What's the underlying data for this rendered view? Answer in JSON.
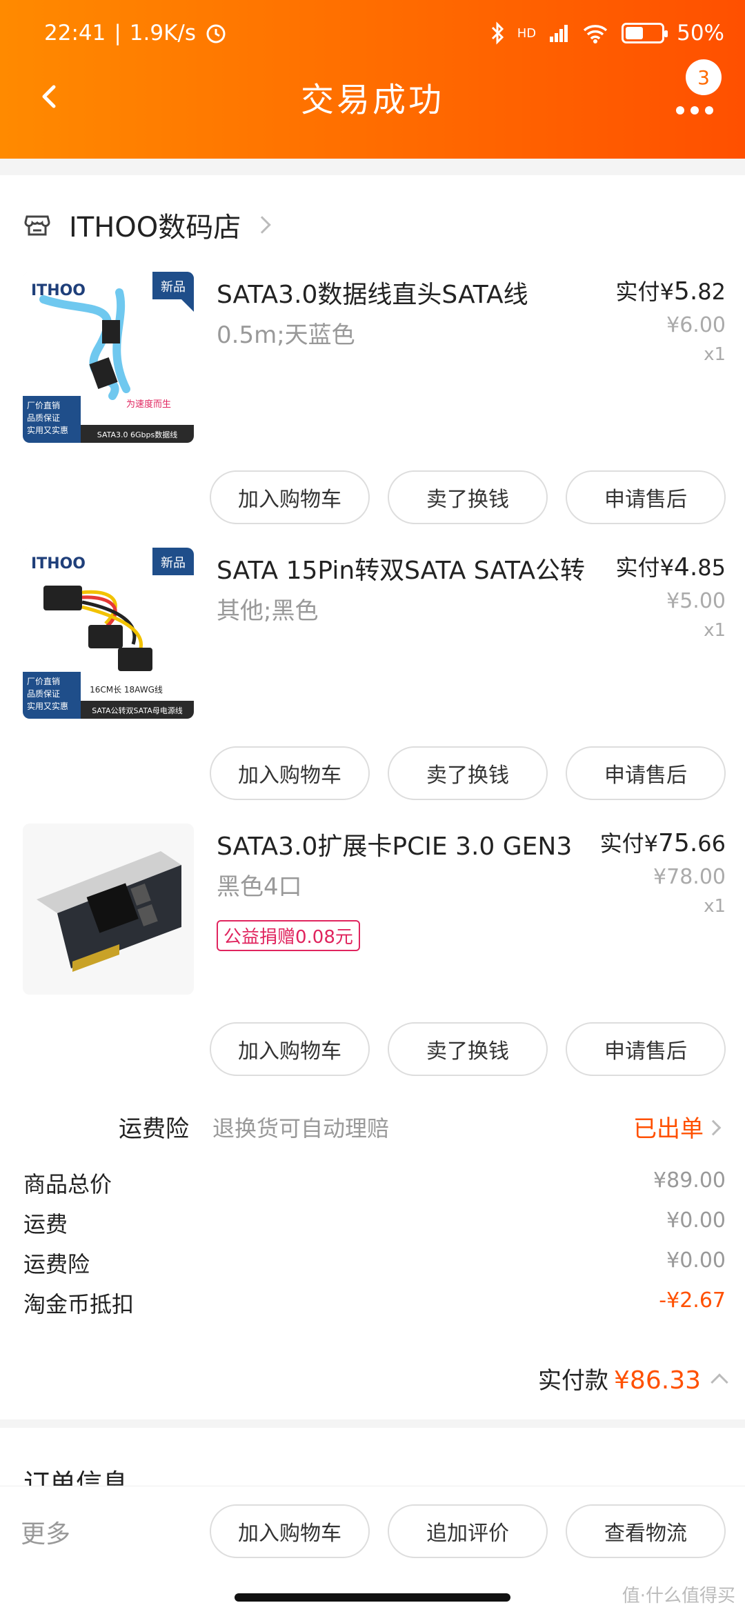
{
  "status": {
    "time": "22:41",
    "speed": "1.9K/s",
    "battery": "50%",
    "network": "HD",
    "battery_fill": 0.5
  },
  "nav": {
    "title": "交易成功",
    "badge": "3"
  },
  "shop": {
    "name": "ITHOO数码店"
  },
  "items": [
    {
      "name": "SATA3.0数据线直头SATA线",
      "sku": "0.5m;天蓝色",
      "paid_label": "实付",
      "currency": "¥",
      "paid_int": "5.",
      "paid_dec": "82",
      "orig": "¥6.00",
      "qty": "x1",
      "buttons": [
        "加入购物车",
        "卖了换钱",
        "申请售后"
      ],
      "thumb_text": {
        "brand": "ITHOO",
        "tag": "新品",
        "l1": "厂价直销",
        "l2": "品质保证",
        "l3": "实用又实惠",
        "spec": "SATA3.0 6Gbps数据线",
        "slogan": "为速度而生"
      }
    },
    {
      "name": "SATA 15Pin转双SATA SATA公转",
      "sku": "其他;黑色",
      "paid_label": "实付",
      "currency": "¥",
      "paid_int": "4.",
      "paid_dec": "85",
      "orig": "¥5.00",
      "qty": "x1",
      "buttons": [
        "加入购物车",
        "卖了换钱",
        "申请售后"
      ],
      "thumb_text": {
        "brand": "ITHOO",
        "tag": "新品",
        "l1": "厂价直销",
        "l2": "品质保证",
        "l3": "实用又实惠",
        "spec": "SATA公转双SATA母电源线",
        "slogan": "16CM长 18AWG线"
      }
    },
    {
      "name": "SATA3.0扩展卡PCIE 3.0 GEN3",
      "sku": "黑色4口",
      "donate": "公益捐赠0.08元",
      "paid_label": "实付",
      "currency": "¥",
      "paid_int": "75.",
      "paid_dec": "66",
      "orig": "¥78.00",
      "qty": "x1",
      "buttons": [
        "加入购物车",
        "卖了换钱",
        "申请售后"
      ]
    }
  ],
  "insurance": {
    "label": "运费险",
    "desc": "退换货可自动理赔",
    "status": "已出单"
  },
  "summary": [
    {
      "k": "商品总价",
      "v": "¥89.00"
    },
    {
      "k": "运费",
      "v": "¥0.00"
    },
    {
      "k": "运费险",
      "v": "¥0.00"
    },
    {
      "k": "淘金币抵扣",
      "v": "-¥2.67"
    }
  ],
  "total": {
    "k": "实付款",
    "v": "¥86.33"
  },
  "order": {
    "title": "订单信息"
  },
  "bottom": {
    "more": "更多",
    "buttons": [
      "加入购物车",
      "追加评价",
      "查看物流"
    ]
  },
  "watermark": "值·什么值得买"
}
